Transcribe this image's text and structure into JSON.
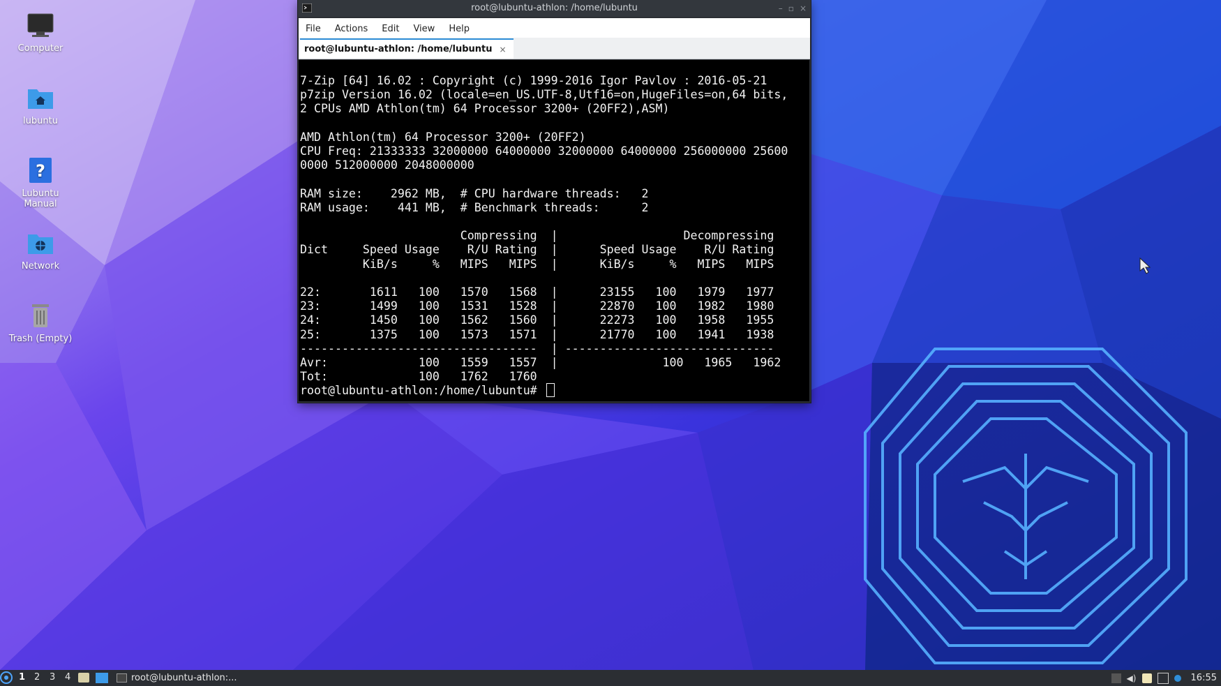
{
  "colors": {
    "wallpaper_light": "#b69ef0",
    "wallpaper_mid": "#5a35e6",
    "wallpaper_blue": "#1d5fd8",
    "logo_glow": "#4ea6ff",
    "tab_accent": "#2f8ed8",
    "terminal_bg": "#000000",
    "terminal_fg": "#f2f2f2"
  },
  "desktop": {
    "icons": [
      {
        "label": "Computer",
        "icon": "computer-icon"
      },
      {
        "label": "lubuntu",
        "icon": "home-folder-icon"
      },
      {
        "label": "Lubuntu Manual",
        "icon": "help-icon"
      },
      {
        "label": "Network",
        "icon": "network-folder-icon"
      },
      {
        "label": "Trash (Empty)",
        "icon": "trash-icon"
      }
    ]
  },
  "window": {
    "title": "root@lubuntu-athlon: /home/lubuntu",
    "menu": [
      "File",
      "Actions",
      "Edit",
      "View",
      "Help"
    ],
    "tab_label": "root@lubuntu-athlon: /home/lubuntu",
    "tab_close": "×",
    "terminal_lines": [
      "7-Zip [64] 16.02 : Copyright (c) 1999-2016 Igor Pavlov : 2016-05-21",
      "p7zip Version 16.02 (locale=en_US.UTF-8,Utf16=on,HugeFiles=on,64 bits,",
      "2 CPUs AMD Athlon(tm) 64 Processor 3200+ (20FF2),ASM)",
      "",
      "AMD Athlon(tm) 64 Processor 3200+ (20FF2)",
      "CPU Freq: 21333333 32000000 64000000 32000000 64000000 256000000 25600",
      "0000 512000000 2048000000",
      "",
      "RAM size:    2962 MB,  # CPU hardware threads:   2",
      "RAM usage:    441 MB,  # Benchmark threads:      2",
      "",
      "                       Compressing  |                  Decompressing",
      "Dict     Speed Usage    R/U Rating  |      Speed Usage    R/U Rating",
      "         KiB/s     %   MIPS   MIPS  |      KiB/s     %   MIPS   MIPS",
      "",
      "22:       1611   100   1570   1568  |      23155   100   1979   1977",
      "23:       1499   100   1531   1528  |      22870   100   1982   1980",
      "24:       1450   100   1562   1560  |      22273   100   1958   1955",
      "25:       1375   100   1573   1571  |      21770   100   1941   1938",
      "----------------------------------  | ------------------------------",
      "Avr:             100   1559   1557  |               100   1965   1962",
      "Tot:             100   1762   1760",
      "root@lubuntu-athlon:/home/lubuntu# "
    ]
  },
  "taskbar": {
    "workspaces": [
      "1",
      "2",
      "3",
      "4"
    ],
    "active_workspace": "1",
    "task_label": "root@lubuntu-athlon:...",
    "clock": "16:55"
  }
}
